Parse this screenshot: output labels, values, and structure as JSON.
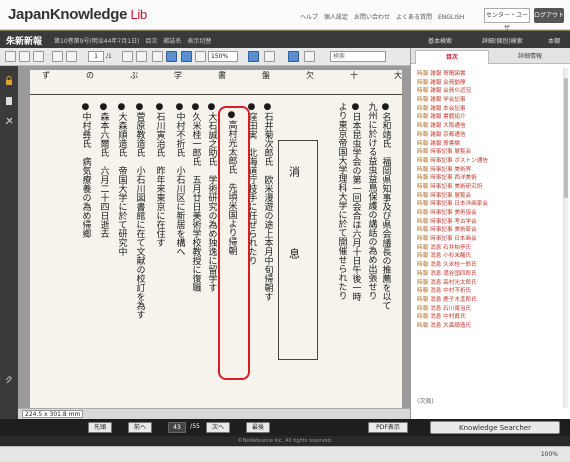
{
  "header": {
    "logo_main": "JapanKnowledge",
    "logo_lib": " Lib",
    "top_links": "ヘルプ　個人設定　お問い合わせ　よくある質問　ENGLISH",
    "user_label": "センター・ユーザ",
    "logout_label": "ログアウト"
  },
  "titlebar": {
    "title": "朱新新報",
    "subtitle": "第10巻第9号(明治44年7月1日)　目次　雑誌名　表示切替",
    "basic_search": "基本検索",
    "detail_search": "詳細(個別)検索",
    "list_label": "本棚"
  },
  "toolbar": {
    "page_current": "1",
    "page_total": "/1",
    "zoom": "150%",
    "search_placeholder": "検索"
  },
  "document": {
    "heading_char": "消　息",
    "columns": [
      "●名和靖氏　福岡県知事及び県会議長の推薦を以て",
      "九州に於ける益虫益鳥保護の講話の為め出張せり",
      "●日本昆虫学会の第一回会合は六月十日午後一時",
      "より東京帝国大学理科大学に於て開催せられたり",
      "●石井菊次郎氏　欧米漫遊の途上本月中旬帰朝す",
      "●窪田実　北海道庁技手に任ぜられたり",
      "●高村光太郎氏　先頃米国より帰朝",
      "●大石誠之助氏　学術研究の為め独逸に留学す",
      "●久米桂一郎氏　五月廿日美術学校教授に復職",
      "●中村不折氏　小石川区に新居を構へ",
      "●石川寅治氏　昨年来東京に在住す",
      "●菅原教造氏　小石川図書館に在て文献の校訂を為す",
      "●大森順造氏　帝国大学に於て研究中",
      "●森本六爾氏　六月二十四日逝去",
      "●中村彝氏　病気療養の為め帰郷"
    ],
    "top_labels": "ず　の　ぶ　学　書　盤　欠　十　大"
  },
  "status": {
    "size_label": "224.5 x 301.8 mm"
  },
  "bottomnav": {
    "first": "先頭",
    "prev": "前へ",
    "page": "43",
    "of": "/55",
    "next": "次へ",
    "last": "最後",
    "pdf": "PDF表示",
    "knowledge_searcher": "Knowledge Searcher"
  },
  "copyright": "©NetAdvance Inc. All rights reserved.",
  "zoom_status": "100%",
  "rpanel": {
    "tab_toc": "目次",
    "tab_detail": "詳細情報",
    "items": [
      {
        "cat": "時報",
        "text": "雑報 寄贈図書"
      },
      {
        "cat": "時報",
        "text": "雑報 会員動静"
      },
      {
        "cat": "時報",
        "text": "雑報 会員の近況"
      },
      {
        "cat": "時報",
        "text": "雑報 学会記事"
      },
      {
        "cat": "時報",
        "text": "雑報 本会記事"
      },
      {
        "cat": "時報",
        "text": "雑報 書籍紹介"
      },
      {
        "cat": "時報",
        "text": "雑報 大阪通信"
      },
      {
        "cat": "時報",
        "text": "雑報 京都通信"
      },
      {
        "cat": "時報",
        "text": "雑報 寄書欄"
      },
      {
        "cat": "時報",
        "text": "時事記事 展覧会"
      },
      {
        "cat": "時報",
        "text": "時事記事 ボストン通信"
      },
      {
        "cat": "時報",
        "text": "時事記事 美術界"
      },
      {
        "cat": "時報",
        "text": "時事記事 西洋美術"
      },
      {
        "cat": "時報",
        "text": "時事記事 美術研究所"
      },
      {
        "cat": "時報",
        "text": "時事記事 展覧会"
      },
      {
        "cat": "時報",
        "text": "時事記事 日本洋画家会"
      },
      {
        "cat": "時報",
        "text": "時事記事 美術協会"
      },
      {
        "cat": "時報",
        "text": "時事記事 考古学会"
      },
      {
        "cat": "時報",
        "text": "時事記事 美術家会"
      },
      {
        "cat": "時報",
        "text": "時事記事 日本画会"
      },
      {
        "cat": "時報",
        "text": "消息 石井柏亭氏"
      },
      {
        "cat": "時報",
        "text": "消息 小杉未醒氏"
      },
      {
        "cat": "時報",
        "text": "消息 久米桂一郎氏"
      },
      {
        "cat": "時報",
        "text": "消息 満谷国四郎氏"
      },
      {
        "cat": "時報",
        "text": "消息 高村光太郎氏"
      },
      {
        "cat": "時報",
        "text": "消息 中村不折氏"
      },
      {
        "cat": "時報",
        "text": "消息 鹿子木孟郎氏"
      },
      {
        "cat": "時報",
        "text": "消息 石川寅治氏"
      },
      {
        "cat": "時報",
        "text": "消息 中村彝氏"
      },
      {
        "cat": "時報",
        "text": "消息 大森順造氏"
      }
    ],
    "footer": "(次頁)"
  }
}
